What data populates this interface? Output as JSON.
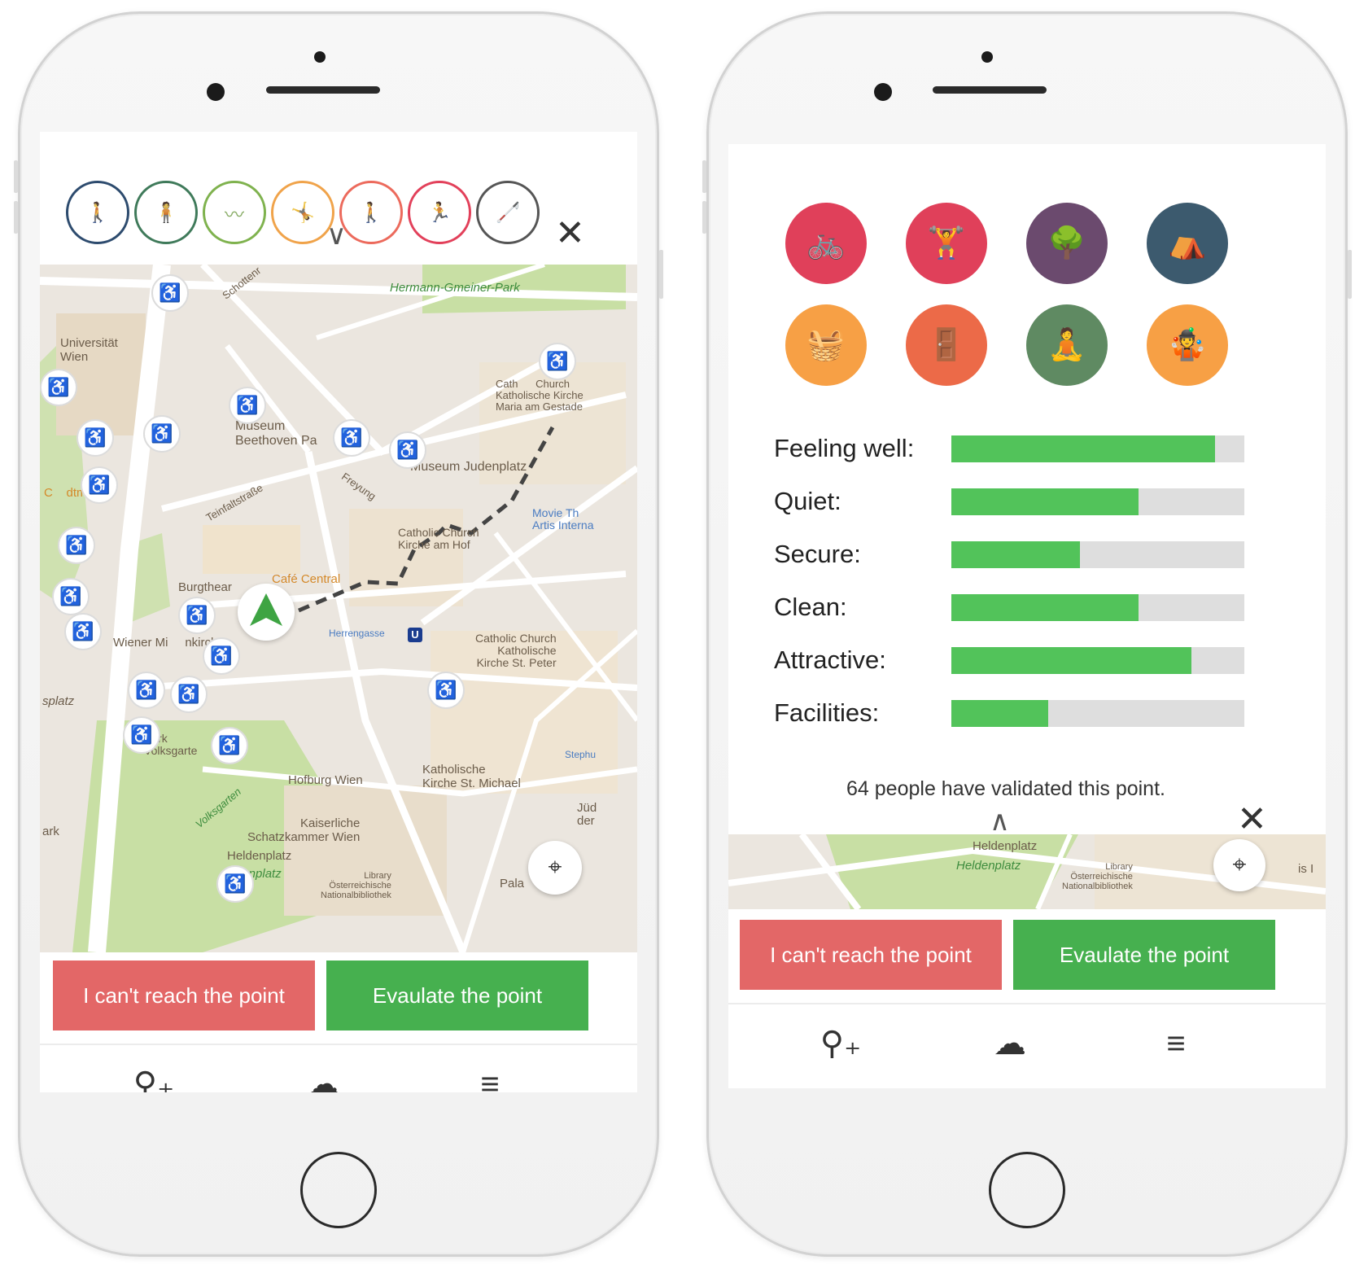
{
  "left_phone": {
    "filter_icons": [
      {
        "icon": "standing-person-icon",
        "color": "#2d4b6e"
      },
      {
        "icon": "sitting-person-icon",
        "color": "#3f7a5a"
      },
      {
        "icon": "lying-person-icon",
        "color": "#7fb24e"
      },
      {
        "icon": "playing-children-icon",
        "color": "#f0a34a"
      },
      {
        "icon": "walking-person-icon",
        "color": "#ec6a5c"
      },
      {
        "icon": "running-person-icon",
        "color": "#e2405a"
      },
      {
        "icon": "person-with-cane-icon",
        "color": "#555555"
      }
    ],
    "map_labels": {
      "hermann_park": "Hermann-Gmeiner-Park",
      "universitat": "Universität\nWien",
      "museum_beethoven": "Museum\nBeethoven Pa",
      "cathedral": "Cath      Church\nKatholische Kirche\nMaria am Gestade",
      "museum_judenplatz": "Museum Judenplatz",
      "movie": "Movie Th\nArtis Interna",
      "church_hof": "Catholic Church\nKirche am Hof",
      "cafe_central": "Café Central",
      "burgtheater": "Burgthear",
      "wiener_minoritenkirche": "Wiener Mi     nkirche",
      "herrengasse": "Herrengasse",
      "catholic_peter": "Catholic Church\nKatholische\nKirche St. Peter",
      "hofburg": "Hofburg Wien",
      "michael": "Katholische\nKirche St. Michael",
      "schatzkammer": "Kaiserliche\nSchatzkammer Wien",
      "heldenplatz": "Heldenplatz",
      "heldenplatz2": "denplatz",
      "library": "Library\nÖsterreichische\nNationalbibliothek",
      "jud": "Jüd\nder",
      "pala": "Pala",
      "volksgarten": "Volksgarten",
      "park": "Park\nVolksgarte",
      "schottenring": "Schottenr",
      "teinfaltstrasse": "Teinfaltstraße",
      "freyung": "Freyung",
      "stephan": "Stephu",
      "landtmann": "C    dtmann",
      "ark": "ark",
      "splatz": "splatz",
      "herrengasse_street": "Herrengasse",
      "gasse": "gasse"
    },
    "buttons": {
      "cant_reach": "I can't reach the point",
      "evaluate": "Evaulate the point"
    },
    "nav": [
      "add-location-icon",
      "cloud-upload-icon",
      "menu-icon"
    ],
    "glyphs": {
      "chevron": "∨",
      "close": "✕",
      "locate": "⌖",
      "add_loc": "⚲₊",
      "cloud": "☁",
      "menu": "≡",
      "metro": "U"
    }
  },
  "right_phone": {
    "categories": [
      {
        "icon": "bicycle-icon",
        "color": "#e0405a"
      },
      {
        "icon": "workout-icon",
        "color": "#e0405a"
      },
      {
        "icon": "park-walk-icon",
        "color": "#6b4a6e"
      },
      {
        "icon": "market-stall-icon",
        "color": "#3c5a6e"
      },
      {
        "icon": "picnic-icon",
        "color": "#f7a045"
      },
      {
        "icon": "door-entrance-icon",
        "color": "#ec6a48"
      },
      {
        "icon": "relaxing-icon",
        "color": "#5f8a62"
      },
      {
        "icon": "children-playing-icon",
        "color": "#f7a045"
      }
    ],
    "ratings": [
      {
        "label": "Feeling well:",
        "value": 0.9
      },
      {
        "label": "Quiet:",
        "value": 0.64
      },
      {
        "label": "Secure:",
        "value": 0.44
      },
      {
        "label": "Clean:",
        "value": 0.64
      },
      {
        "label": "Attractive:",
        "value": 0.82
      },
      {
        "label": "Facilities:",
        "value": 0.33
      }
    ],
    "validated_text": "64 people have validated this point.",
    "map_labels": {
      "heldenplatz": "Heldenplatz",
      "heldenplatz2": "Heldenplatz",
      "library": "Library\nÖsterreichische\nNationalbibliothek",
      "edge": "is I"
    },
    "buttons": {
      "cant_reach": "I can't reach the point",
      "evaluate": "Evaulate the point"
    },
    "glyphs": {
      "chevron_up": "∧",
      "close": "✕",
      "locate": "⌖",
      "add_loc": "⚲₊",
      "cloud": "☁",
      "menu": "≡"
    }
  }
}
